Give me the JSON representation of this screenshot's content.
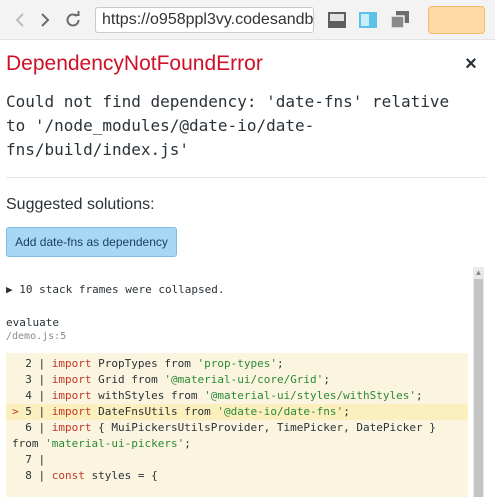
{
  "browser": {
    "url": "https://o958ppl3vy.codesandbox.io/",
    "icons": [
      "back-arrow-icon",
      "forward-arrow-icon",
      "reload-icon",
      "layout-left-icon",
      "layout-split-icon",
      "windows-icon"
    ],
    "accent_color": "#ffd9a8"
  },
  "error": {
    "title": "DependencyNotFoundError",
    "close_label": "×",
    "message": "Could not find dependency: 'date-fns' relative to '/node_modules/@date-io/date-fns/build/index.js'",
    "title_color": "#ce1126"
  },
  "suggestions": {
    "title": "Suggested solutions:",
    "button_label": "Add date-fns as dependency"
  },
  "stack": {
    "collapsed_label": "▶ 10 stack frames were collapsed.",
    "function_name": "evaluate",
    "location": "/demo.js:5",
    "code_lines": [
      {
        "marker": "  ",
        "num": "2",
        "kw": "import",
        "mid": " PropTypes from ",
        "str": "'prop-types'",
        "tail": ";"
      },
      {
        "marker": "  ",
        "num": "3",
        "kw": "import",
        "mid": " Grid from ",
        "str": "'@material-ui/core/Grid'",
        "tail": ";"
      },
      {
        "marker": "  ",
        "num": "4",
        "kw": "import",
        "mid": " withStyles from ",
        "str": "'@material-ui/styles/withStyles'",
        "tail": ";"
      },
      {
        "marker": "> ",
        "num": "5",
        "kw": "import",
        "mid": " DateFnsUtils from ",
        "str": "'@date-io/date-fns'",
        "tail": ";"
      },
      {
        "marker": "  ",
        "num": "6",
        "kw": "import",
        "mid": " { MuiPickersUtilsProvider, TimePicker, DatePicker }",
        "str": "",
        "tail": ""
      },
      {
        "marker": "",
        "num": "",
        "kw": "",
        "mid": "from ",
        "str": "'material-ui-pickers'",
        "tail": ";"
      },
      {
        "marker": "  ",
        "num": "7",
        "kw": "",
        "mid": "",
        "str": "",
        "tail": ""
      },
      {
        "marker": "  ",
        "num": "8",
        "kw": "const",
        "mid": " styles = {",
        "str": "",
        "tail": ""
      }
    ]
  }
}
